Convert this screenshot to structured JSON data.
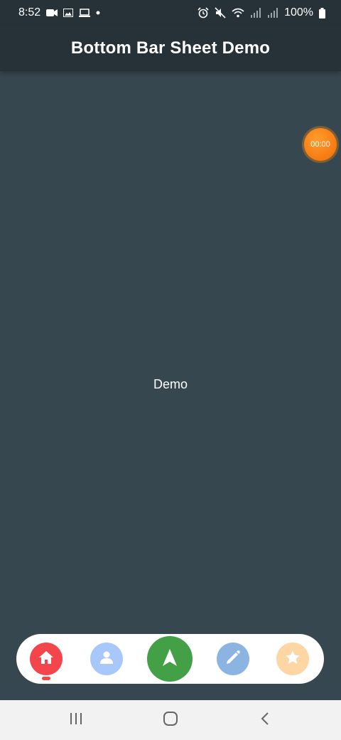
{
  "status_bar": {
    "time": "8:52",
    "battery": "100%",
    "left_icons": [
      "video-camera-icon",
      "image-icon",
      "laptop-icon",
      "dot-icon"
    ],
    "right_icons": [
      "alarm-icon",
      "mute-icon",
      "wifi-icon",
      "signal-icon",
      "signal-icon",
      "battery-icon"
    ]
  },
  "app_bar": {
    "title": "Bottom Bar Sheet Demo"
  },
  "timer": {
    "label": "00:00"
  },
  "main": {
    "text": "Demo"
  },
  "bottom_nav": {
    "active_index": 0,
    "items": [
      {
        "icon": "home-icon",
        "color": "#f2464c"
      },
      {
        "icon": "person-icon",
        "color": "#a8c7fa"
      },
      {
        "icon": "navigation-arrow-icon",
        "color": "#43a047"
      },
      {
        "icon": "pencil-icon",
        "color": "#8cb4e3"
      },
      {
        "icon": "star-icon",
        "color": "#fdd6a4"
      }
    ]
  },
  "system_nav": {
    "icons": [
      "recent-apps-icon",
      "home-circle-icon",
      "back-icon"
    ]
  },
  "colors": {
    "background": "#37474f",
    "app_bar": "#263238",
    "timer": "#f57c00"
  }
}
